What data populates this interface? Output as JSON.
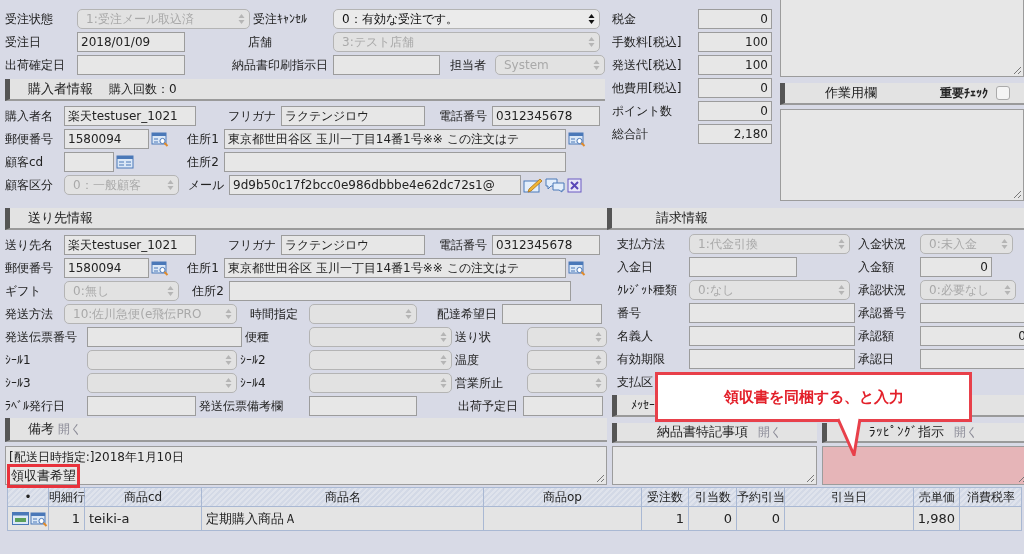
{
  "order": {
    "rows": [
      [
        {
          "label": "受注状態",
          "kind": "select",
          "value": "1:受注メール取込済",
          "disabled": true
        },
        {
          "label": "受注ｷｬﾝｾﾙ",
          "kind": "select",
          "value": "0：有効な受注です。",
          "disabled": false
        }
      ],
      [
        {
          "label": "受注日",
          "kind": "text",
          "value": "2018/01/09"
        },
        {
          "label": "店舗",
          "kind": "select",
          "value": "3:テスト店舗",
          "disabled": true
        }
      ],
      [
        {
          "label": "出荷確定日",
          "kind": "text"
        },
        {
          "label": "納品書印刷指示日",
          "kind": "text"
        },
        {
          "label": "担当者",
          "kind": "select",
          "value": "System",
          "disabled": true
        }
      ]
    ]
  },
  "totals": [
    {
      "label": "税金",
      "value": "0"
    },
    {
      "label": "手数料[税込]",
      "value": "100"
    },
    {
      "label": "発送代[税込]",
      "value": "100"
    },
    {
      "label": "他費用[税込]",
      "value": "0"
    },
    {
      "label": "ポイント数",
      "value": "0"
    },
    {
      "label": "総合計",
      "value": "2,180"
    }
  ],
  "work_area": {
    "title": "作業用欄",
    "important_check": {
      "label": "重要ﾁｪｯｸ",
      "checked": false
    }
  },
  "buyer": {
    "title": "購入者情報",
    "purchase_count": "購入回数：0",
    "rows": [
      [
        {
          "label": "購入者名",
          "kind": "text",
          "value": "楽天testuser_1021"
        },
        {
          "label": "フリガナ",
          "kind": "text",
          "value": "ラクテンジロウ"
        },
        {
          "label": "電話番号",
          "kind": "text",
          "value": "0312345678"
        }
      ],
      [
        {
          "label": "郵便番号",
          "kind": "text",
          "value": "1580094"
        },
        {
          "label": "住所1",
          "kind": "text",
          "value": "東京都世田谷区 玉川一丁目14番1号※※ この注文はテ"
        }
      ],
      [
        {
          "label": "顧客cd",
          "kind": "text"
        },
        {
          "label": "住所2",
          "kind": "text"
        }
      ],
      [
        {
          "label": "顧客区分",
          "kind": "select",
          "value": "0：一般顧客",
          "disabled": true
        },
        {
          "label": "メール",
          "kind": "text",
          "value": "9d9b50c17f2bcc0e986dbbbe4e62dc72s1@"
        }
      ]
    ]
  },
  "shipping": {
    "title": "送り先情報",
    "rows": [
      [
        {
          "label": "送り先名",
          "kind": "text",
          "value": "楽天testuser_1021"
        },
        {
          "label": "フリガナ",
          "kind": "text",
          "value": "ラクテンジロウ"
        },
        {
          "label": "電話番号",
          "kind": "text",
          "value": "0312345678"
        }
      ],
      [
        {
          "label": "郵便番号",
          "kind": "text",
          "value": "1580094"
        },
        {
          "label": "住所1",
          "kind": "text",
          "value": "東京都世田谷区 玉川一丁目14番1号※※ この注文はテ"
        }
      ],
      [
        {
          "label": "ギフト",
          "kind": "select",
          "value": "0:無し",
          "disabled": true
        },
        {
          "label": "住所2",
          "kind": "text"
        }
      ],
      [
        {
          "label": "発送方法",
          "kind": "select",
          "value": "10:佐川急便(e飛伝PRO",
          "disabled": true
        },
        {
          "label": "時間指定",
          "kind": "select",
          "disabled": true
        },
        {
          "label": "配達希望日",
          "kind": "text"
        }
      ],
      [
        {
          "label": "発送伝票番号",
          "kind": "text"
        },
        {
          "label": "便種",
          "kind": "select",
          "disabled": true
        },
        {
          "label": "送り状",
          "kind": "select",
          "disabled": true
        }
      ],
      [
        {
          "label": "ｼｰﾙ1",
          "kind": "select",
          "disabled": true
        },
        {
          "label": "ｼｰﾙ2",
          "kind": "select",
          "disabled": true
        },
        {
          "label": "温度",
          "kind": "select",
          "disabled": true
        }
      ],
      [
        {
          "label": "ｼｰﾙ3",
          "kind": "select",
          "disabled": true
        },
        {
          "label": "ｼｰﾙ4",
          "kind": "select",
          "disabled": true
        },
        {
          "label": "営業所止",
          "kind": "select",
          "disabled": true
        }
      ],
      [
        {
          "label": "ﾗﾍﾞﾙ発行日",
          "kind": "text"
        },
        {
          "label": "発送伝票備考欄",
          "kind": "text"
        },
        {
          "label": "出荷予定日",
          "kind": "text"
        }
      ]
    ]
  },
  "billing": {
    "title": "請求情報",
    "rows": [
      [
        {
          "label": "支払方法",
          "kind": "select",
          "value": "1:代金引換",
          "disabled": true
        },
        {
          "label": "入金状況",
          "kind": "select",
          "value": "0:未入金",
          "disabled": true
        }
      ],
      [
        {
          "label": "入金日",
          "kind": "text"
        },
        {
          "label": "入金額",
          "kind": "number",
          "value": "0"
        }
      ],
      [
        {
          "label": "ｸﾚｼﾞｯﾄ種類",
          "kind": "select",
          "value": "0:なし",
          "disabled": true
        },
        {
          "label": "承認状況",
          "kind": "select",
          "value": "0:必要なし",
          "disabled": true
        }
      ],
      [
        {
          "label": "番号",
          "kind": "text"
        },
        {
          "label": "承認番号",
          "kind": "text"
        }
      ],
      [
        {
          "label": "名義人",
          "kind": "text"
        },
        {
          "label": "承認額",
          "kind": "number",
          "value": "0"
        }
      ],
      [
        {
          "label": "有効期限",
          "kind": "text"
        },
        {
          "label": "承認日",
          "kind": "text"
        }
      ],
      [
        {
          "label": "支払区",
          "kind": "label"
        }
      ]
    ]
  },
  "message": {
    "title": "ﾒｯｾｰ"
  },
  "remarks": {
    "title": "備考",
    "open_link": "開く",
    "lines": [
      {
        "text": "[配送日時指定:]2018年1月10日",
        "highlighted": false
      },
      {
        "text": "領収書希望",
        "highlighted": true
      }
    ]
  },
  "delivery_note": {
    "title": "納品書特記事項",
    "open_link": "開く"
  },
  "wrapping": {
    "title": "ﾗｯﾋﾟﾝｸﾞ指示",
    "open_link": "開く",
    "highlighted": true
  },
  "table": {
    "columns": [
      "•",
      "明細行",
      "商品cd",
      "商品名",
      "商品op",
      "受注数",
      "引当数",
      "予約引当",
      "引当日",
      "売単価",
      "消費税率"
    ],
    "rows": [
      {
        "line": "1",
        "code": "teiki-a",
        "name": "定期購入商品Ａ",
        "ordered": "1",
        "allocated": "0",
        "reserved": "0",
        "unit_price": "1,980"
      }
    ]
  },
  "callout": {
    "text": "領収書を同梱する、と入力"
  }
}
